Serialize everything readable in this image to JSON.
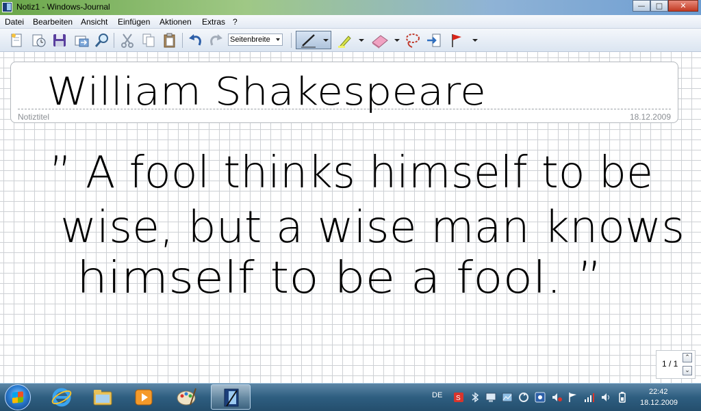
{
  "window": {
    "title": "Notiz1 - Windows-Journal",
    "minimize_icon": "minimize-icon",
    "maximize_icon": "maximize-icon",
    "close_icon": "close-icon"
  },
  "menu": {
    "items": [
      "Datei",
      "Bearbeiten",
      "Ansicht",
      "Einfügen",
      "Aktionen",
      "Extras",
      "?"
    ]
  },
  "toolbar": {
    "icons": [
      "new-note-icon",
      "open-icon",
      "save-icon",
      "send-icon",
      "find-icon",
      "cut-icon",
      "copy-icon",
      "paste-icon",
      "undo-icon",
      "redo-icon",
      "pen-icon",
      "highlighter-icon",
      "eraser-icon",
      "lasso-icon",
      "insert-space-icon",
      "flag-icon"
    ],
    "zoom_value": "Seitenbreite",
    "accent_color": "#5f7590"
  },
  "note": {
    "title_label": "Notiztitel",
    "date": "18.12.2009",
    "ink_title": "William Shakespeare",
    "ink_lines": [
      "” A fool thinks himself to be",
      "wise, but a wise man knows",
      "himself to be a fool. ”"
    ],
    "page_indicator": "1 / 1"
  },
  "taskbar": {
    "pinned_icons": [
      "start-orb-icon",
      "internet-explorer-icon",
      "explorer-folder-icon",
      "media-player-icon",
      "paint-icon",
      "windows-journal-icon"
    ],
    "language": "DE",
    "tray_icons": [
      "security-icon",
      "bluetooth-icon",
      "display-icon",
      "network-monitor-icon",
      "update-icon",
      "sync-icon",
      "speaker-alert-icon",
      "flag-icon",
      "signal-icon",
      "volume-icon",
      "battery-icon"
    ],
    "time": "22:42",
    "date": "18.12.2009"
  }
}
